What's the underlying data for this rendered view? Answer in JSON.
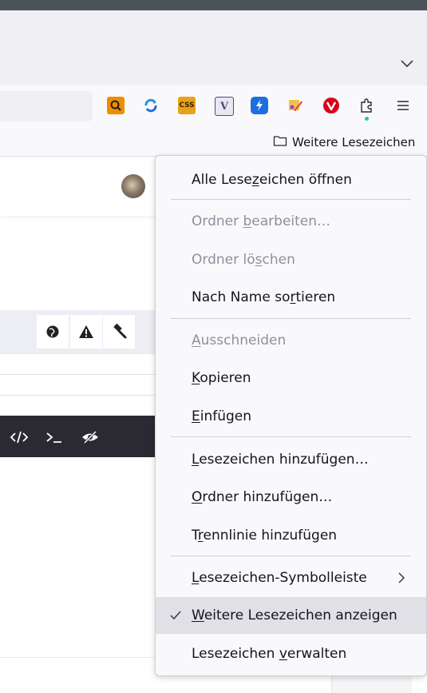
{
  "bookmarks_bar": {
    "folder_label": "Weitere Lesezeichen"
  },
  "extensions": [
    {
      "name": "search-ext-icon",
      "color": "#f08c00"
    },
    {
      "name": "refresh-ext-icon",
      "color": "#2b8fe3"
    },
    {
      "name": "css-ext-icon",
      "color": "#e9a01b",
      "text": "CSS"
    },
    {
      "name": "validator-ext-icon",
      "color": "#4b4b88",
      "text": "V"
    },
    {
      "name": "lightning-ext-icon",
      "color": "#1d6fe0"
    },
    {
      "name": "paint-ext-icon",
      "color": "#e24b3b"
    },
    {
      "name": "vivaldi-ext-icon",
      "color": "#d9001b",
      "text": "v"
    },
    {
      "name": "puzzle-extensions-icon"
    },
    {
      "name": "hamburger-menu-icon"
    }
  ],
  "context_menu": {
    "items": [
      {
        "label_pre": "Alle Lese",
        "accel": "z",
        "label_post": "eichen öffnen",
        "disabled": false
      },
      {
        "label_pre": "Ordner ",
        "accel": "b",
        "label_post": "earbeiten…",
        "disabled": true
      },
      {
        "label_pre": "Ordner lö",
        "accel": "s",
        "label_post": "chen",
        "disabled": true
      },
      {
        "label_pre": "Nach Name so",
        "accel": "r",
        "label_post": "tieren",
        "disabled": false
      },
      {
        "label_pre": "",
        "accel": "A",
        "label_post": "usschneiden",
        "disabled": true
      },
      {
        "label_pre": "",
        "accel": "K",
        "label_post": "opieren",
        "disabled": false
      },
      {
        "label_pre": "",
        "accel": "E",
        "label_post": "infügen",
        "disabled": false
      },
      {
        "label_pre": "",
        "accel": "L",
        "label_post": "esezeichen hinzufügen…",
        "disabled": false
      },
      {
        "label_pre": "",
        "accel": "O",
        "label_post": "rdner hinzufügen…",
        "disabled": false
      },
      {
        "label_pre": "T",
        "accel": "r",
        "label_post": "ennlinie hinzufügen",
        "disabled": false
      },
      {
        "label_pre": "",
        "accel": "L",
        "label_post": "esezeichen-Symbolleiste",
        "disabled": false,
        "submenu": true
      },
      {
        "label_pre": "",
        "accel": "W",
        "label_post": "eitere Lesezeichen anzeigen",
        "disabled": false,
        "checked": true
      },
      {
        "label_pre": "Lesezeichen ",
        "accel": "v",
        "label_post": "erwalten",
        "disabled": false
      }
    ]
  }
}
